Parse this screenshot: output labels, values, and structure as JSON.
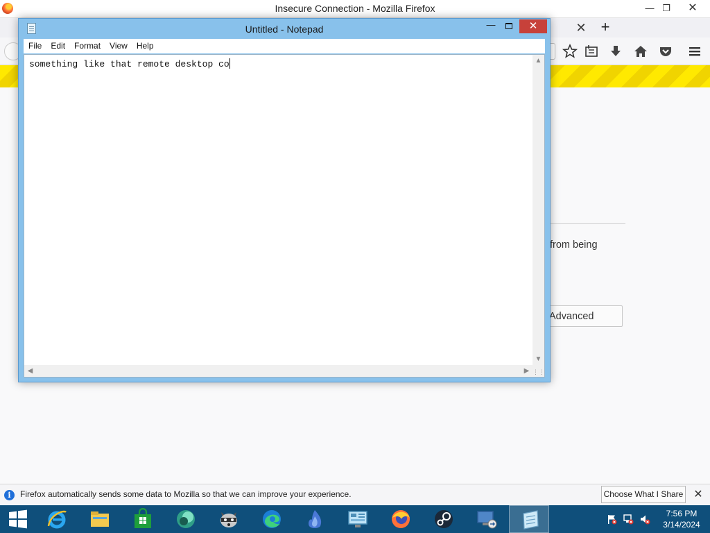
{
  "firefox": {
    "window_title": "Insecure Connection - Mozilla Firefox",
    "body_text_fragment": "from being",
    "advanced_button": "Advanced",
    "notification": {
      "text": "Firefox automatically sends some data to Mozilla so that we can improve your experience.",
      "choose_button": "Choose What I Share"
    },
    "warning_bar_color": "#ffe900"
  },
  "notepad": {
    "title": "Untitled - Notepad",
    "menu": [
      "File",
      "Edit",
      "Format",
      "View",
      "Help"
    ],
    "content": "something like that remote desktop co",
    "close_color": "#c7413a",
    "frame_color": "#88c1eb"
  },
  "taskbar": {
    "apps": [
      {
        "name": "internet-explorer-icon",
        "active": false
      },
      {
        "name": "file-explorer-icon",
        "active": false
      },
      {
        "name": "store-icon",
        "active": false
      },
      {
        "name": "green-app-icon",
        "active": false
      },
      {
        "name": "raccoon-app-icon",
        "active": false
      },
      {
        "name": "edge-icon",
        "active": false
      },
      {
        "name": "blue-flame-icon",
        "active": false
      },
      {
        "name": "control-panel-icon",
        "active": false
      },
      {
        "name": "firefox-icon",
        "active": false
      },
      {
        "name": "steam-icon",
        "active": false
      },
      {
        "name": "remote-desktop-icon",
        "active": false
      },
      {
        "name": "notepad-icon",
        "active": true
      }
    ],
    "clock": {
      "time": "7:56 PM",
      "date": "3/14/2024"
    },
    "color": "#0f4f7b"
  }
}
